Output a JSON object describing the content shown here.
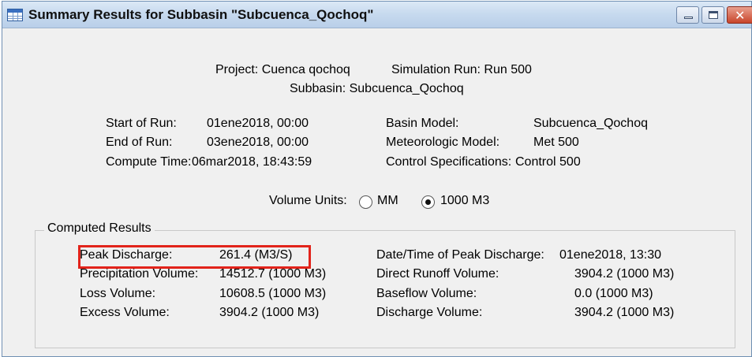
{
  "window": {
    "title": "Summary Results for Subbasin \"Subcuenca_Qochoq\""
  },
  "header": {
    "project": "Project: Cuenca qochoq",
    "simulation_run": "Simulation Run: Run 500",
    "subbasin": "Subbasin: Subcuenca_Qochoq"
  },
  "run_info": {
    "start_label": "Start of Run:",
    "start_value": "01ene2018, 00:00",
    "end_label": "End of Run:",
    "end_value": "03ene2018, 00:00",
    "compute_label": "Compute Time:",
    "compute_value": "06mar2018, 18:43:59",
    "basin_label": "Basin Model:",
    "basin_value": "Subcuenca_Qochoq",
    "met_label": "Meteorologic Model:",
    "met_value": "Met 500",
    "control_label": "Control Specifications:",
    "control_value": "Control 500"
  },
  "volume_units": {
    "label": "Volume Units:",
    "options": [
      "MM",
      "1000 M3"
    ],
    "selected": "1000 M3"
  },
  "computed_results": {
    "title": "Computed Results",
    "left": [
      {
        "label": "Peak Discharge:",
        "value": "261.4 (M3/S)"
      },
      {
        "label": "Precipitation Volume:",
        "value": "14512.7 (1000 M3)"
      },
      {
        "label": "Loss Volume:",
        "value": "10608.5 (1000 M3)"
      },
      {
        "label": "Excess Volume:",
        "value": "3904.2 (1000 M3)"
      }
    ],
    "right": [
      {
        "label": "Date/Time of Peak Discharge:",
        "value": "01ene2018, 13:30"
      },
      {
        "label": "Direct Runoff Volume:",
        "value": "3904.2 (1000 M3)"
      },
      {
        "label": "Baseflow Volume:",
        "value": "0.0 (1000 M3)"
      },
      {
        "label": "Discharge Volume:",
        "value": "3904.2 (1000 M3)"
      }
    ]
  },
  "colors": {
    "highlight_border": "#e2231a",
    "titlebar": "#c6d9ee",
    "background": "#f0f0f0"
  },
  "icons": {
    "app": "table-window-icon",
    "minimize": "minimize-icon",
    "maximize": "maximize-icon",
    "close": "close-icon"
  }
}
